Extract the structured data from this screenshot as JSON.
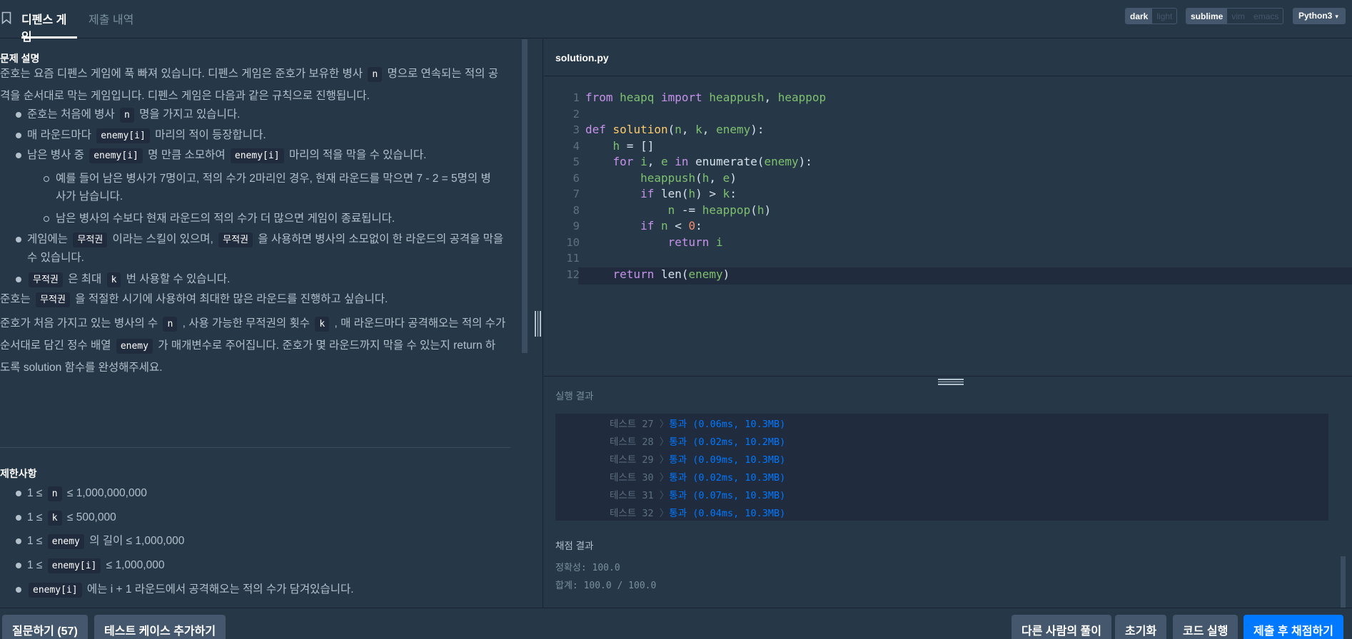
{
  "tabs": [
    {
      "label": "디펜스 게임",
      "active": true
    },
    {
      "label": "제출 내역",
      "active": false
    }
  ],
  "theme": {
    "options": [
      "dark",
      "light"
    ],
    "selected": "dark"
  },
  "keymap": {
    "options": [
      "sublime",
      "vim",
      "emacs"
    ],
    "selected": "sublime"
  },
  "language": {
    "selected": "Python3"
  },
  "description": {
    "heading": "문제 설명",
    "intro": [
      "준호는 요즘 디펜스 게임에 푹 빠져 있습니다. 디펜스 게임은 준호가 보유한 병사 ",
      "n",
      " 명으로 연속되는 적의 공",
      "격을 순서대로 막는 게임입니다. 디펜스 게임은 다음과 같은 규칙으로 진행됩니다."
    ],
    "rule1": [
      "준호는 처음에 병사 ",
      "n",
      " 명을 가지고 있습니다."
    ],
    "rule2": [
      "매 라운드마다 ",
      "enemy[i]",
      " 마리의 적이 등장합니다."
    ],
    "rule3": [
      "남은 병사 중 ",
      "enemy[i]",
      " 명 만큼 소모하여 ",
      "enemy[i]",
      " 마리의 적을 막을 수 있습니다."
    ],
    "rule3a": [
      "예를 들어 남은 병사가 7명이고, 적의 수가 2마리인 경우, 현재 라운드를 막으면 7 - 2 = 5명의 병",
      "사가 남습니다."
    ],
    "rule3b": "남은 병사의 수보다 현재 라운드의 적의 수가 더 많으면 게임이 종료됩니다.",
    "rule4": [
      "게임에는 ",
      "무적권",
      " 이라는 스킬이 있으며, ",
      "무적권",
      " 을 사용하면 병사의 소모없이 한 라운드의 공격을 막을",
      "수 있습니다."
    ],
    "rule5": [
      "무적권",
      " 은 최대 ",
      "k",
      " 번 사용할 수 있습니다."
    ],
    "goal": [
      "준호는 ",
      "무적권",
      " 을 적절한 시기에 사용하여 최대한 많은 라운드를 진행하고 싶습니다."
    ],
    "task": [
      "준호가 처음 가지고 있는 병사의 수 ",
      "n",
      " , 사용 가능한 무적권의 횟수 ",
      "k",
      " , 매 라운드마다 공격해오는 적의 수가",
      "순서대로 담긴 정수 배열 ",
      "enemy",
      " 가 매개변수로 주어집니다. 준호가 몇 라운드까지 막을 수 있는지 return 하",
      "도록 solution 함수를 완성해주세요."
    ]
  },
  "constraints": {
    "heading": "제한사항",
    "c1": [
      "1 ≤ ",
      "n",
      " ≤ 1,000,000,000"
    ],
    "c2": [
      "1 ≤ ",
      "k",
      " ≤ 500,000"
    ],
    "c3": [
      "1 ≤ ",
      "enemy",
      " 의 길이 ≤ 1,000,000"
    ],
    "c4": [
      "1 ≤ ",
      "enemy[i]",
      " ≤ 1,000,000"
    ],
    "c5": [
      "enemy[i]",
      " 에는 i + 1 라운드에서 공격해오는 적의 수가 담겨있습니다."
    ]
  },
  "editor": {
    "filename": "solution.py",
    "line_numbers": [
      "1",
      "2",
      "3",
      "4",
      "5",
      "6",
      "7",
      "8",
      "9",
      "10",
      "11",
      "12"
    ]
  },
  "results": {
    "title": "실행 결과",
    "tests": [
      {
        "label": "테스트 27",
        "result": "통과 (0.06ms, 10.3MB)"
      },
      {
        "label": "테스트 28",
        "result": "통과 (0.02ms, 10.2MB)"
      },
      {
        "label": "테스트 29",
        "result": "통과 (0.09ms, 10.3MB)"
      },
      {
        "label": "테스트 30",
        "result": "통과 (0.02ms, 10.3MB)"
      },
      {
        "label": "테스트 31",
        "result": "통과 (0.07ms, 10.3MB)"
      },
      {
        "label": "테스트 32",
        "result": "통과 (0.04ms, 10.3MB)"
      }
    ],
    "grading_title": "채점 결과",
    "accuracy": "정확성: 100.0",
    "total": "합계: 100.0 / 100.0"
  },
  "bottom": {
    "ask": "질문하기 (57)",
    "add_case": "테스트 케이스 추가하기",
    "others": "다른 사람의 풀이",
    "reset": "초기화",
    "run": "코드 실행",
    "submit": "제출 후 채점하기"
  },
  "colors": {
    "accent": "#0078ff",
    "background": "#263747",
    "panel": "#202b3d"
  }
}
